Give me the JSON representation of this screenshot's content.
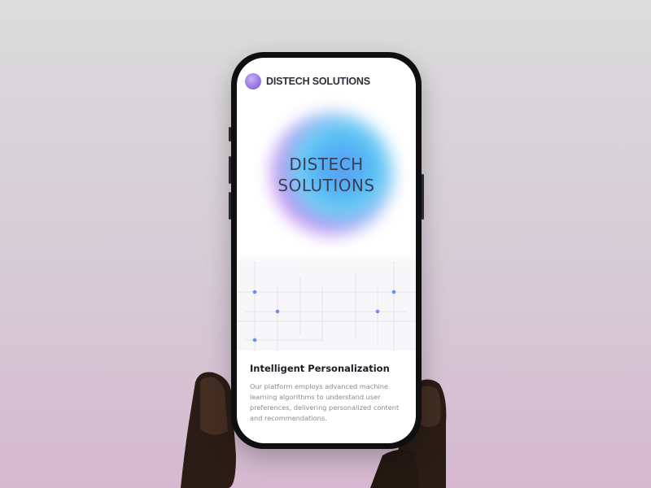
{
  "header": {
    "brand": "DISTECH SOLUTIONS"
  },
  "hero": {
    "title_line1": "DISTECH",
    "title_line2": "SOLUTIONS"
  },
  "feature": {
    "title": "Intelligent Personalization",
    "description": "Our platform employs advanced machine learning algorithms to understand user preferences, delivering personalized content and recommendations."
  },
  "colors": {
    "accent_dot": "#6b8ff0",
    "logo": "#9b7ae6",
    "background_top": "#dcdcdc",
    "background_bottom": "#d6b9d0"
  },
  "icons": {
    "logo": "gradient-circle-logo-icon"
  }
}
